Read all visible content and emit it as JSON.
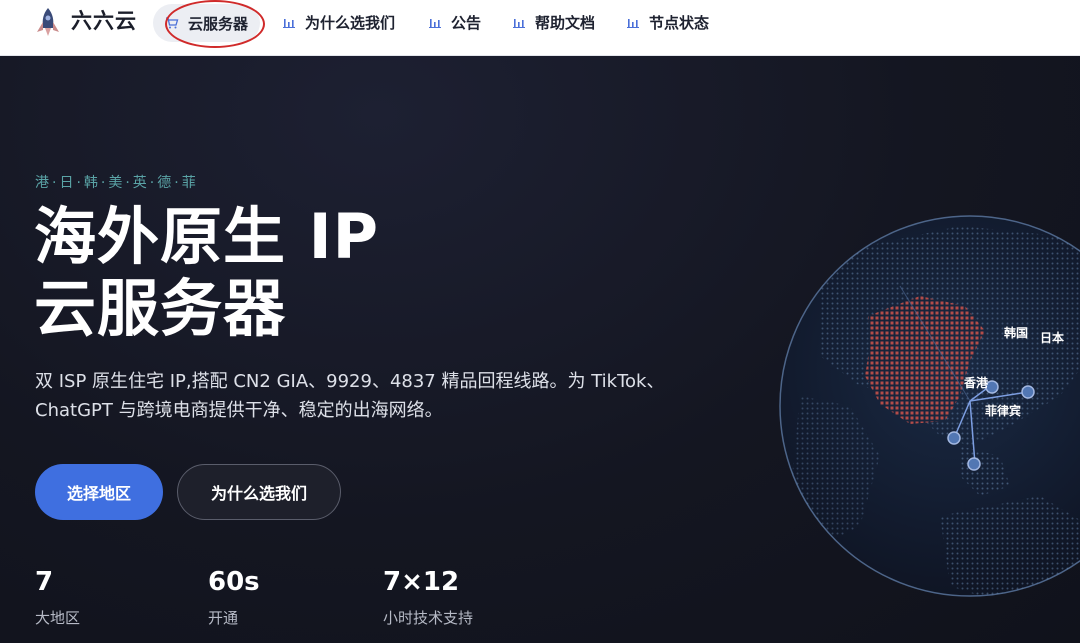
{
  "nav": {
    "brand": "六六云",
    "items": [
      {
        "label": "云服务器",
        "icon": "cart-icon",
        "active": true
      },
      {
        "label": "为什么选我们",
        "icon": "bar-chart-icon"
      },
      {
        "label": "公告",
        "icon": "bar-chart-icon"
      },
      {
        "label": "帮助文档",
        "icon": "bar-chart-icon"
      },
      {
        "label": "节点状态",
        "icon": "bar-chart-icon"
      }
    ]
  },
  "hero": {
    "kicker": "港·日·韩·美·英·德·菲",
    "title_line1": "海外原生 IP",
    "title_line2": "云服务器",
    "description": "双 ISP 原生住宅 IP,搭配 CN2 GIA、9929、4837 精品回程线路。为 TikTok、ChatGPT 与跨境电商提供干净、稳定的出海网络。",
    "primary_button": "选择地区",
    "secondary_button": "为什么选我们"
  },
  "stats": [
    {
      "value": "7",
      "label": "大地区"
    },
    {
      "value": "60s",
      "label": "开通"
    },
    {
      "value": "7×12",
      "label": "小时技术支持"
    }
  ],
  "map": {
    "labels": [
      "韩国",
      "日本",
      "香港",
      "菲律宾"
    ]
  },
  "colors": {
    "accent": "#3f6fe0",
    "hero_bg": "#141621",
    "kicker": "#5aa3a6",
    "annotation": "#d02a2a",
    "highlight_region": "#d0544c"
  }
}
